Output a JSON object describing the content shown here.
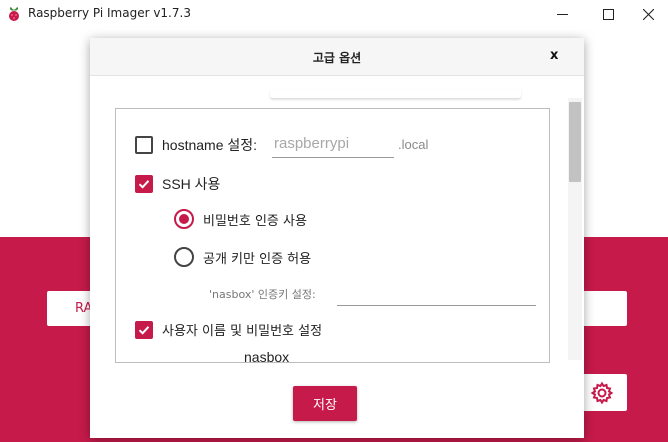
{
  "app": {
    "title": "Raspberry Pi Imager v1.7.3",
    "accent_color": "#c51a4a",
    "icon": "raspberry-logo"
  },
  "background": {
    "left_button_label": "RA",
    "gear_icon": "gear-icon"
  },
  "dialog": {
    "title": "고급 옵션",
    "close_label": "x",
    "hostname": {
      "label": "hostname 설정:",
      "placeholder": "raspberrypi",
      "value": "",
      "suffix": ".local",
      "checked": false
    },
    "ssh": {
      "label": "SSH 사용",
      "checked": true,
      "password_auth_label": "비밀번호 인증 사용",
      "password_auth_selected": true,
      "pubkey_auth_label": "공개 키만 인증 허용",
      "pubkey_auth_selected": false,
      "authorized_key_label": "'nasbox' 인증키 설정:",
      "authorized_key_value": ""
    },
    "user": {
      "label": "사용자 이름 및 비밀번호 설정",
      "checked": true,
      "username_partial": "nasbox"
    },
    "save_label": "저장"
  }
}
